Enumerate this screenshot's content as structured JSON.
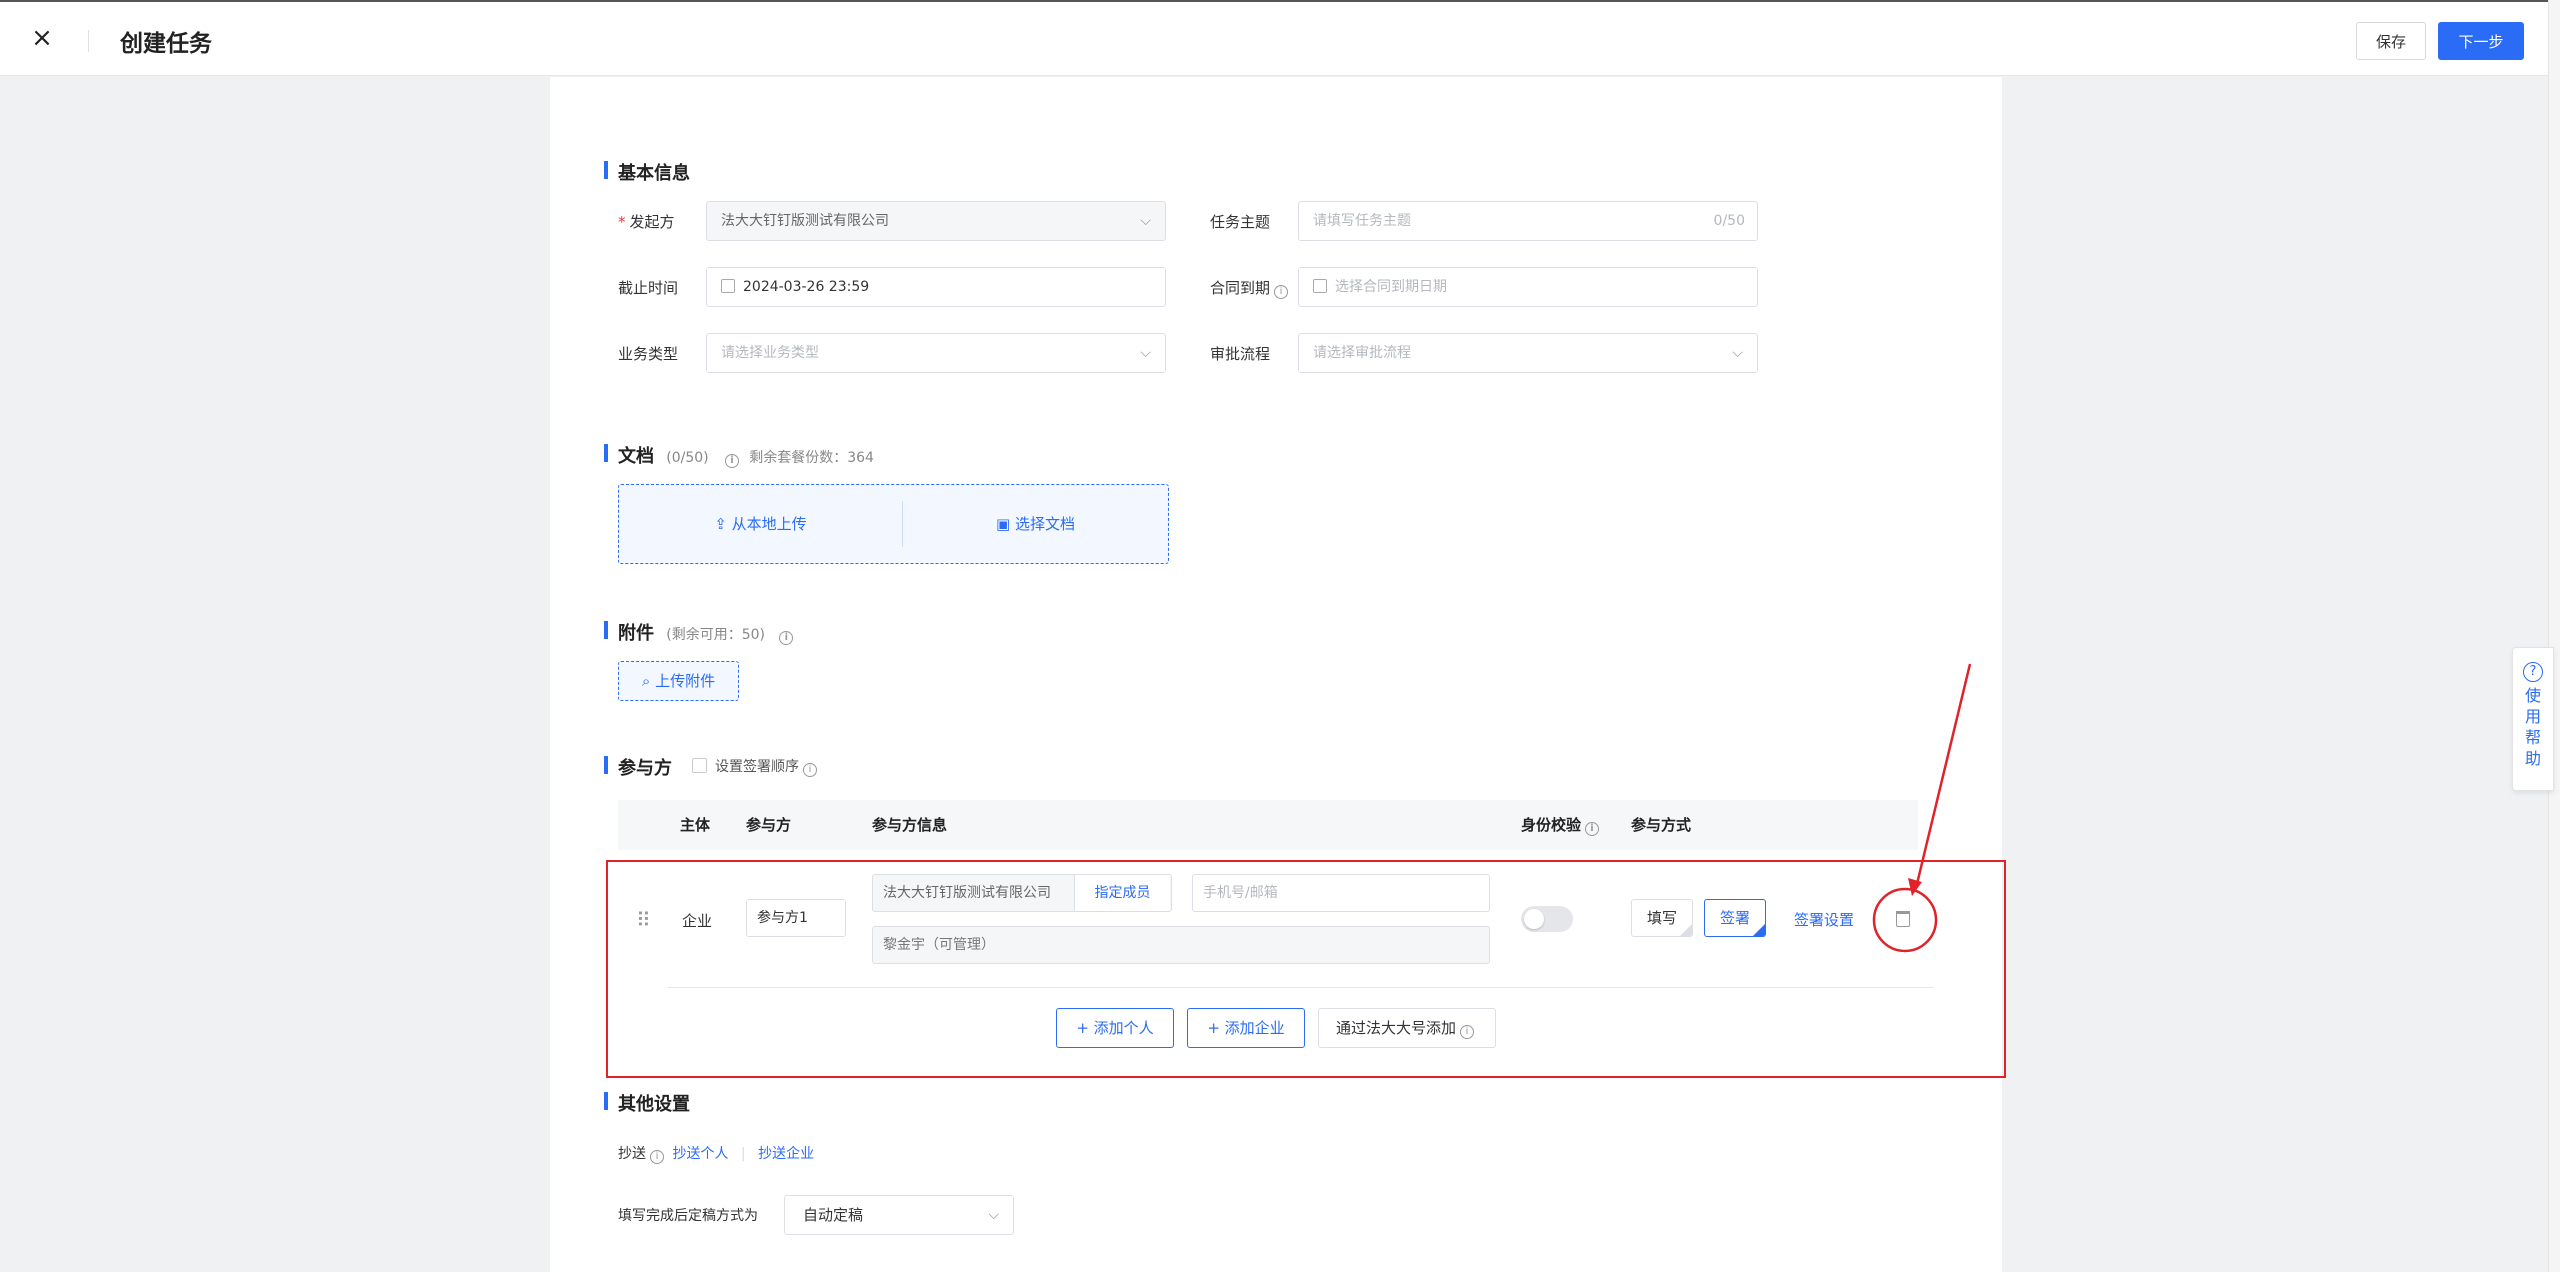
{
  "header": {
    "close_icon": "close-icon",
    "title": "创建任务",
    "save_label": "保存",
    "next_label": "下一步"
  },
  "basic_info": {
    "title": "基本信息",
    "initiator_label": "发起方",
    "initiator_required": "*",
    "initiator_value": "法大大钉钉版测试有限公司",
    "subject_label": "任务主题",
    "subject_placeholder": "请填写任务主题",
    "subject_counter": "0/50",
    "deadline_label": "截止时间",
    "deadline_value": "2024-03-26 23:59",
    "contract_expiry_label": "合同到期",
    "contract_expiry_placeholder": "选择合同到期日期",
    "business_type_label": "业务类型",
    "business_type_placeholder": "请选择业务类型",
    "approval_label": "审批流程",
    "approval_placeholder": "请选择审批流程"
  },
  "documents": {
    "title": "文档",
    "count": "(0/50)",
    "remaining": "剩余套餐份数：364",
    "upload_local": "从本地上传",
    "choose_doc": "选择文档"
  },
  "attachments": {
    "title": "附件",
    "remaining": "(剩余可用：50)",
    "upload_label": "上传附件"
  },
  "participants": {
    "title": "参与方",
    "sign_order_label": "设置签署顺序",
    "columns": {
      "subject": "主体",
      "party": "参与方",
      "party_info": "参与方信息",
      "identity_check": "身份校验",
      "participation": "参与方式"
    },
    "rows": [
      {
        "subject": "企业",
        "party_name": "参与方1",
        "company": "法大大钉钉版测试有限公司",
        "assign_member": "指定成员",
        "contact_placeholder": "手机号/邮箱",
        "member": "黎金宇（可管理）",
        "identity_check_on": false,
        "mode_fill": "填写",
        "mode_sign": "签署",
        "sign_settings": "签署设置",
        "delete_icon": "trash-icon"
      }
    ],
    "add_person": "+ 添加个人",
    "add_company": "+ 添加企业",
    "add_via_fadada": "通过法大大号添加"
  },
  "other_settings": {
    "title": "其他设置",
    "cc_label": "抄送",
    "cc_person": "抄送个人",
    "cc_company": "抄送企业",
    "finalize_label": "填写完成后定稿方式为",
    "finalize_value": "自动定稿"
  },
  "help": {
    "text": "使用帮助"
  },
  "colors": {
    "primary": "#2b6cf6",
    "annotation": "#e0232a"
  }
}
